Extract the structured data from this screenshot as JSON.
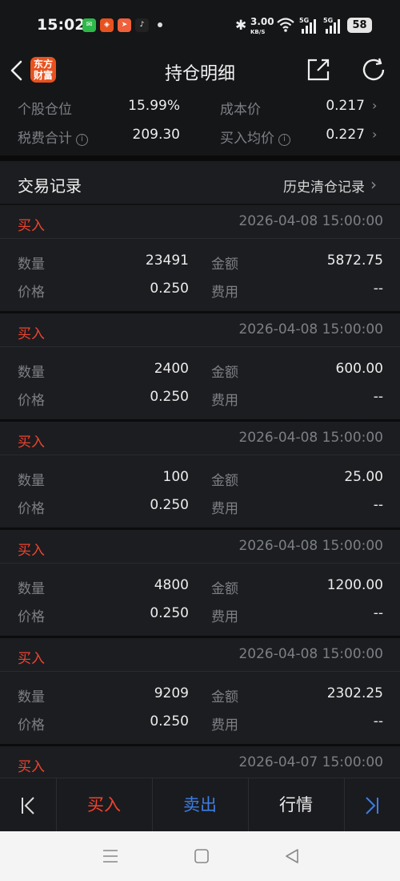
{
  "status": {
    "time": "15:02",
    "net_speed_top": "3.00",
    "net_speed_unit": "KB/S",
    "signal1": "5G",
    "signal2": "5G",
    "battery": "58",
    "apps": [
      {
        "icon": "wechat-icon",
        "color": "#2fb84a"
      },
      {
        "icon": "shopping-app-icon",
        "color": "#e8521f"
      },
      {
        "icon": "paper-plane-app-icon",
        "color": "#f0603a"
      },
      {
        "icon": "tiktok-icon",
        "color": "#222222"
      }
    ]
  },
  "header": {
    "title": "持仓明细",
    "logo_line1": "东方",
    "logo_line2": "财富"
  },
  "summary": {
    "position_label": "个股仓位",
    "position_value": "15.99%",
    "cost_label": "成本价",
    "cost_value": "0.217",
    "fee_label": "税费合计",
    "fee_value": "209.30",
    "avg_label": "买入均价",
    "avg_value": "0.227"
  },
  "section": {
    "title": "交易记录",
    "history_link": "历史清仓记录"
  },
  "labels": {
    "qty": "数量",
    "price": "价格",
    "amount": "金额",
    "fee": "费用"
  },
  "records": [
    {
      "type": "买入",
      "date": "2026-04-08 15:00:00",
      "qty": "23491",
      "price": "0.250",
      "amount": "5872.75",
      "fee": "--"
    },
    {
      "type": "买入",
      "date": "2026-04-08 15:00:00",
      "qty": "2400",
      "price": "0.250",
      "amount": "600.00",
      "fee": "--"
    },
    {
      "type": "买入",
      "date": "2026-04-08 15:00:00",
      "qty": "100",
      "price": "0.250",
      "amount": "25.00",
      "fee": "--"
    },
    {
      "type": "买入",
      "date": "2026-04-08 15:00:00",
      "qty": "4800",
      "price": "0.250",
      "amount": "1200.00",
      "fee": "--"
    },
    {
      "type": "买入",
      "date": "2026-04-08 15:00:00",
      "qty": "9209",
      "price": "0.250",
      "amount": "2302.25",
      "fee": "--"
    },
    {
      "type": "买入",
      "date": "2026-04-07 15:00:00"
    }
  ],
  "bottombar": {
    "buy": "买入",
    "sell": "卖出",
    "market": "行情"
  },
  "colors": {
    "buy": "#f0432f",
    "sell": "#3d7de6",
    "accent": "#e8521f"
  }
}
